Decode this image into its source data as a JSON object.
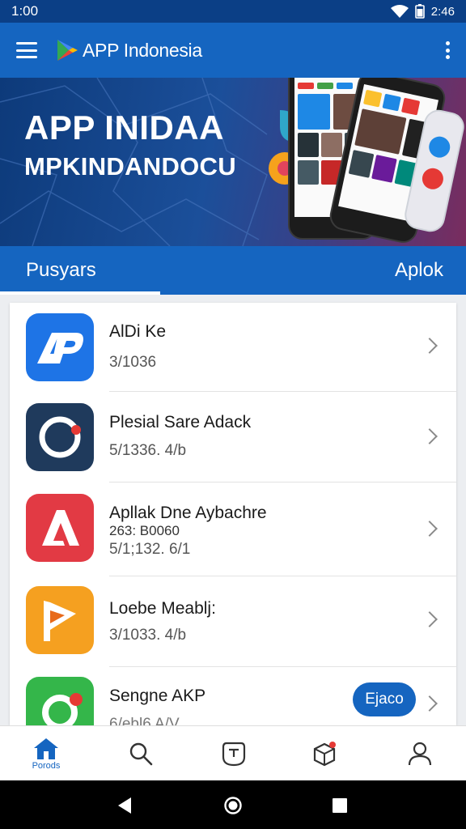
{
  "status_bar": {
    "time": "1:00",
    "right_text": "2:46"
  },
  "app_bar": {
    "title": "APP Indonesia",
    "menu_icon": "hamburger-menu-icon",
    "overflow_icon": "more-vert-icon"
  },
  "banner": {
    "line1": "APP INIDAA",
    "line2": "MPKINDANDOCU"
  },
  "tabs": [
    {
      "label": "Pusyars",
      "selected": true
    },
    {
      "label": "Aplok",
      "selected": false
    }
  ],
  "apps": [
    {
      "name": "AlDi Ke",
      "meta": "3/1036",
      "color": "#1e74e6"
    },
    {
      "name": "Plesial Sare Adack",
      "meta": "5/1336. 4/b",
      "color": "#1f3a5c"
    },
    {
      "name": "Apllak Dne Aybachre",
      "meta_top": "263: B0060",
      "meta": "5/1;132. 6/1",
      "color": "#e23a44"
    },
    {
      "name": "Loebe Meablj:",
      "meta": "3/1033. 4/b",
      "color": "#f5a020"
    },
    {
      "name": "Sengne AKP",
      "meta": "6/ebl6 A/V...",
      "color": "#34b64a",
      "action": "Ejaco"
    }
  ],
  "bottom_nav": {
    "home_label": "Porods",
    "items": [
      "home-icon",
      "search-icon",
      "games-icon",
      "apps-box-icon",
      "account-icon"
    ]
  },
  "colors": {
    "primary": "#1565c0",
    "status_bar": "#0b3f86"
  }
}
